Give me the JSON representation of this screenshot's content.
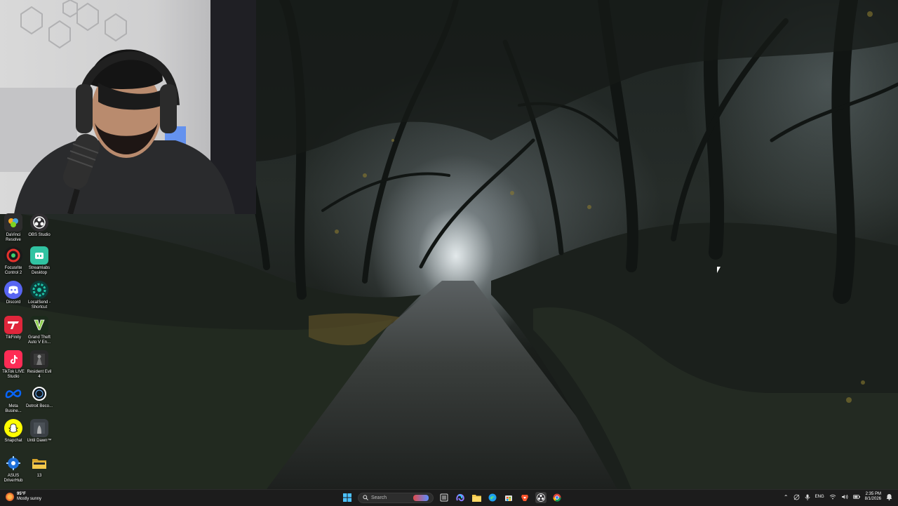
{
  "desktop": {
    "icons": [
      {
        "label": "DaVinci Resolve",
        "icon": "davinci-resolve-icon",
        "color": "#2d2d2d",
        "accent": "#f5a623"
      },
      {
        "label": "OBS Studio",
        "icon": "obs-studio-icon",
        "color": "#302e31",
        "accent": "#ffffff"
      },
      {
        "label": "Focusrite Control 2",
        "icon": "focusrite-icon",
        "color": "#1a1a1a",
        "accent": "#e6322c"
      },
      {
        "label": "Streamlabs Desktop",
        "icon": "streamlabs-icon",
        "color": "#31c3a2",
        "accent": "#ffffff"
      },
      {
        "label": "Discord",
        "icon": "discord-icon",
        "color": "#5865f2",
        "accent": "#ffffff"
      },
      {
        "label": "LocalSend - Shortcut",
        "icon": "localsend-icon",
        "color": "#0b3d3a",
        "accent": "#1fc4a8"
      },
      {
        "label": "TikFinity",
        "icon": "tikfinity-icon",
        "color": "#e0263b",
        "accent": "#ffffff"
      },
      {
        "label": "Grand Theft Auto V En...",
        "icon": "gta-v-icon",
        "color": "#1b2a1b",
        "accent": "#8fd14f"
      },
      {
        "label": "TikTok LIVE Studio",
        "icon": "tiktok-live-icon",
        "color": "#fe2c55",
        "accent": "#25f4ee"
      },
      {
        "label": "Resident Evil 4",
        "icon": "resident-evil-icon",
        "color": "#2a2a2a",
        "accent": "#9a9a9a"
      },
      {
        "label": "Meta Busine...",
        "icon": "meta-business-icon",
        "color": "#0866ff",
        "accent": "#ffffff"
      },
      {
        "label": "Detroit Beco...",
        "icon": "detroit-become-human-icon",
        "color": "#101820",
        "accent": "#ffffff"
      },
      {
        "label": "Snapchat",
        "icon": "snapchat-icon",
        "color": "#fffc00",
        "accent": "#000000"
      },
      {
        "label": "Until Dawn™",
        "icon": "until-dawn-icon",
        "color": "#3a3f44",
        "accent": "#c9c9c9"
      },
      {
        "label": "ASUS DriverHub",
        "icon": "asus-driverhub-icon",
        "color": "#1e6fd9",
        "accent": "#ffffff"
      },
      {
        "label": "13",
        "icon": "folder-icon",
        "color": "#f3c84b",
        "accent": "#d9a52a"
      }
    ]
  },
  "taskbar": {
    "weather": {
      "temp": "95°F",
      "condition": "Mostly sunny",
      "icon": "sun-icon"
    },
    "search_placeholder": "Search",
    "pinned": [
      "windows-start-icon",
      "search-icon",
      "task-view-icon",
      "copilot-icon",
      "file-explorer-icon",
      "edge-icon",
      "microsoft-store-icon",
      "brave-icon",
      "obs-icon",
      "chrome-icon"
    ],
    "tray": {
      "language": "ENG"
    },
    "clock": {
      "time": "2:35 PM",
      "date": "8/1/2026"
    }
  }
}
